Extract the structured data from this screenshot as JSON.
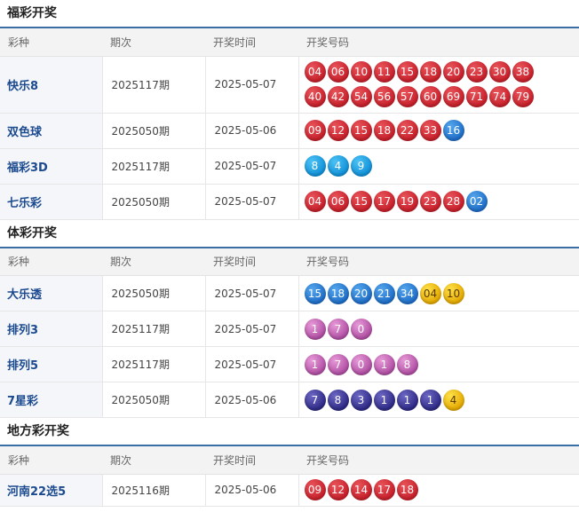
{
  "sections": [
    {
      "title": "福彩开奖",
      "headers": [
        "彩种",
        "期次",
        "开奖时间",
        "开奖号码"
      ],
      "rows": [
        {
          "name": "快乐8",
          "period": "2025117期",
          "date": "2025-05-07",
          "balls": [
            [
              "04",
              "red"
            ],
            [
              "06",
              "red"
            ],
            [
              "10",
              "red"
            ],
            [
              "11",
              "red"
            ],
            [
              "15",
              "red"
            ],
            [
              "18",
              "red"
            ],
            [
              "20",
              "red"
            ],
            [
              "23",
              "red"
            ],
            [
              "30",
              "red"
            ],
            [
              "38",
              "red"
            ],
            [
              "40",
              "red"
            ],
            [
              "42",
              "red"
            ],
            [
              "54",
              "red"
            ],
            [
              "56",
              "red"
            ],
            [
              "57",
              "red"
            ],
            [
              "60",
              "red"
            ],
            [
              "69",
              "red"
            ],
            [
              "71",
              "red"
            ],
            [
              "74",
              "red"
            ],
            [
              "79",
              "red"
            ]
          ]
        },
        {
          "name": "双色球",
          "period": "2025050期",
          "date": "2025-05-06",
          "balls": [
            [
              "09",
              "red"
            ],
            [
              "12",
              "red"
            ],
            [
              "15",
              "red"
            ],
            [
              "18",
              "red"
            ],
            [
              "22",
              "red"
            ],
            [
              "33",
              "red"
            ],
            [
              "16",
              "blue"
            ]
          ]
        },
        {
          "name": "福彩3D",
          "period": "2025117期",
          "date": "2025-05-07",
          "balls": [
            [
              "8",
              "lblue"
            ],
            [
              "4",
              "lblue"
            ],
            [
              "9",
              "lblue"
            ]
          ]
        },
        {
          "name": "七乐彩",
          "period": "2025050期",
          "date": "2025-05-07",
          "balls": [
            [
              "04",
              "red"
            ],
            [
              "06",
              "red"
            ],
            [
              "15",
              "red"
            ],
            [
              "17",
              "red"
            ],
            [
              "19",
              "red"
            ],
            [
              "23",
              "red"
            ],
            [
              "28",
              "red"
            ],
            [
              "02",
              "blue"
            ]
          ]
        }
      ]
    },
    {
      "title": "体彩开奖",
      "headers": [
        "彩种",
        "期次",
        "开奖时间",
        "开奖号码"
      ],
      "rows": [
        {
          "name": "大乐透",
          "period": "2025050期",
          "date": "2025-05-07",
          "balls": [
            [
              "15",
              "blue"
            ],
            [
              "18",
              "blue"
            ],
            [
              "20",
              "blue"
            ],
            [
              "21",
              "blue"
            ],
            [
              "34",
              "blue"
            ],
            [
              "04",
              "yellow"
            ],
            [
              "10",
              "yellow"
            ]
          ]
        },
        {
          "name": "排列3",
          "period": "2025117期",
          "date": "2025-05-07",
          "balls": [
            [
              "1",
              "purple"
            ],
            [
              "7",
              "purple"
            ],
            [
              "0",
              "purple"
            ]
          ]
        },
        {
          "name": "排列5",
          "period": "2025117期",
          "date": "2025-05-07",
          "balls": [
            [
              "1",
              "purple"
            ],
            [
              "7",
              "purple"
            ],
            [
              "0",
              "purple"
            ],
            [
              "1",
              "purple"
            ],
            [
              "8",
              "purple"
            ]
          ]
        },
        {
          "name": "7星彩",
          "period": "2025050期",
          "date": "2025-05-06",
          "balls": [
            [
              "7",
              "navy"
            ],
            [
              "8",
              "navy"
            ],
            [
              "3",
              "navy"
            ],
            [
              "1",
              "navy"
            ],
            [
              "1",
              "navy"
            ],
            [
              "1",
              "navy"
            ],
            [
              "4",
              "yellow"
            ]
          ]
        }
      ]
    },
    {
      "title": "地方彩开奖",
      "headers": [
        "彩种",
        "期次",
        "开奖时间",
        "开奖号码"
      ],
      "rows": [
        {
          "name": "河南22选5",
          "period": "2025116期",
          "date": "2025-05-06",
          "balls": [
            [
              "09",
              "red"
            ],
            [
              "12",
              "red"
            ],
            [
              "14",
              "red"
            ],
            [
              "17",
              "red"
            ],
            [
              "18",
              "red"
            ]
          ]
        }
      ]
    }
  ],
  "colors": {
    "header_border": "#3a6ea5",
    "name_text": "#1c4a8f",
    "red_ball": "#c8202b",
    "blue_ball": "#1e6ec8"
  }
}
